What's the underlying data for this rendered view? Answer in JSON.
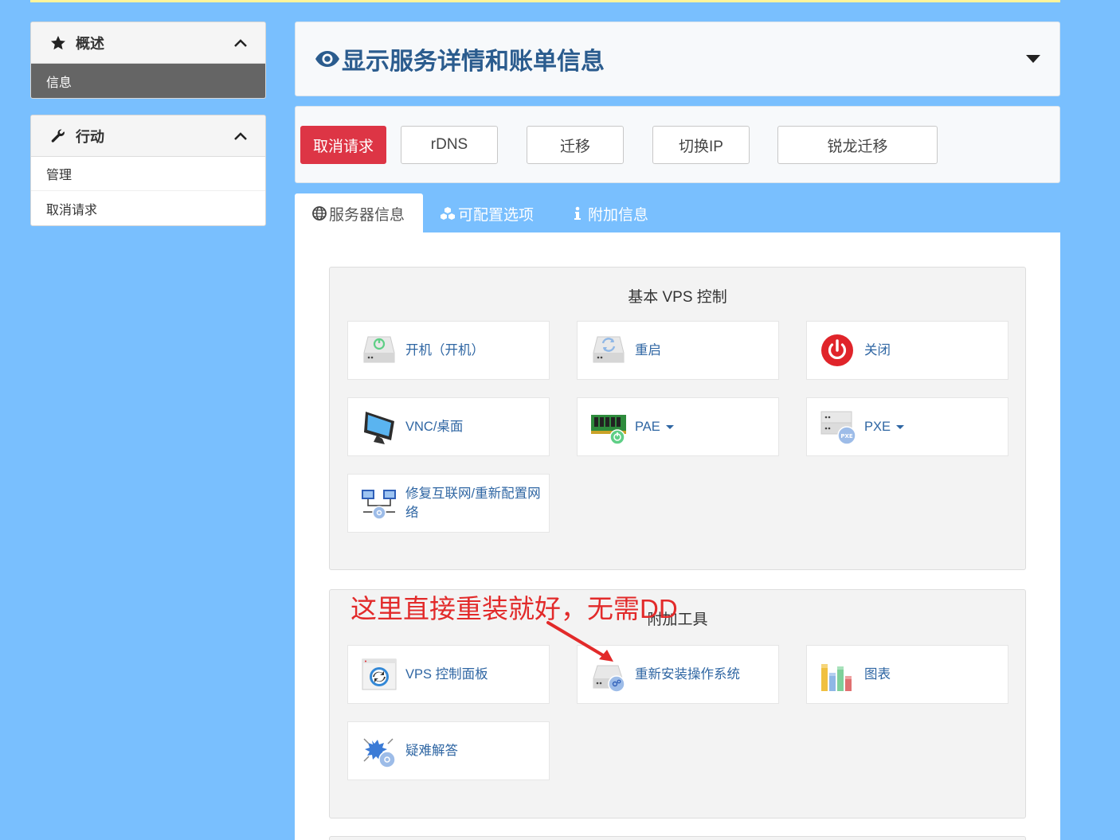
{
  "sidebar": {
    "overview": {
      "title": "概述",
      "items": [
        "信息"
      ]
    },
    "actions": {
      "title": "行动",
      "items": [
        "管理",
        "取消请求"
      ]
    }
  },
  "header": {
    "title": "显示服务详情和账单信息"
  },
  "buttons": [
    "取消请求",
    "rDNS",
    "迁移",
    "切换IP",
    "锐龙迁移"
  ],
  "tabs": [
    "服务器信息",
    "可配置选项",
    "附加信息"
  ],
  "basic_controls": {
    "title": "基本 VPS 控制",
    "tiles": [
      "开机（开机）",
      "重启",
      "关闭",
      "VNC/桌面",
      "PAE",
      "PXE",
      "修复互联网/重新配置网络"
    ]
  },
  "addon_tools": {
    "title": "附加工具",
    "tiles": [
      "VPS 控制面板",
      "重新安装操作系统",
      "图表",
      "疑难解答"
    ]
  },
  "annotation": "这里直接重装就好，无需DD",
  "colors": {
    "background": "#79bffe",
    "danger": "#dd3545",
    "title": "#2b5c8e",
    "link": "#2f66a3",
    "annotation": "#e22a2a"
  }
}
